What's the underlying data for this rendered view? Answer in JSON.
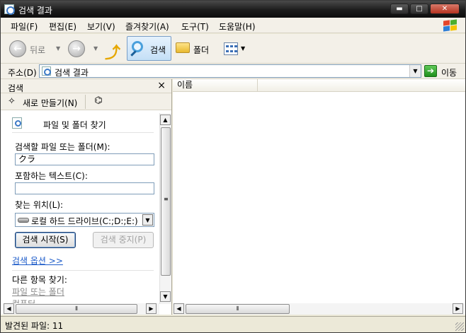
{
  "window": {
    "title": "검색 결과",
    "minimize": "▬",
    "maximize": "□",
    "close": "✕"
  },
  "menu": [
    "파일(F)",
    "편집(E)",
    "보기(V)",
    "즐겨찾기(A)",
    "도구(T)",
    "도움말(H)"
  ],
  "toolbar": {
    "back": "뒤로",
    "search": "검색",
    "folders": "폴더"
  },
  "address": {
    "label": "주소(D)",
    "value": "검색 결과",
    "go": "이동"
  },
  "search_pane": {
    "title": "검색",
    "close": "×",
    "new_search": "새로 만들기(N)",
    "section_title": "파일 및 폴더 찾기",
    "name_label": "검색할 파일 또는 폴더(M):",
    "name_value": "クラ",
    "text_label": "포함하는 텍스트(C):",
    "text_value": "",
    "location_label": "찾는 위치(L):",
    "location_value": "로컬 하드 드라이브(C:;D:;E:)",
    "start_button": "검색 시작(S)",
    "stop_button": "검색 중지(P)",
    "options_link": "검색 옵션 >>",
    "other_label": "다른 항목 찾기:",
    "other_links": [
      "파일 또는 폴더",
      "컴퓨터"
    ]
  },
  "results": {
    "columns": [
      "이름"
    ]
  },
  "status": {
    "text": "발견된 파일: 11"
  },
  "colors": {
    "titlebar": "#1c1c1c",
    "link": "#1c5bc9",
    "go": "#2ea82a"
  }
}
